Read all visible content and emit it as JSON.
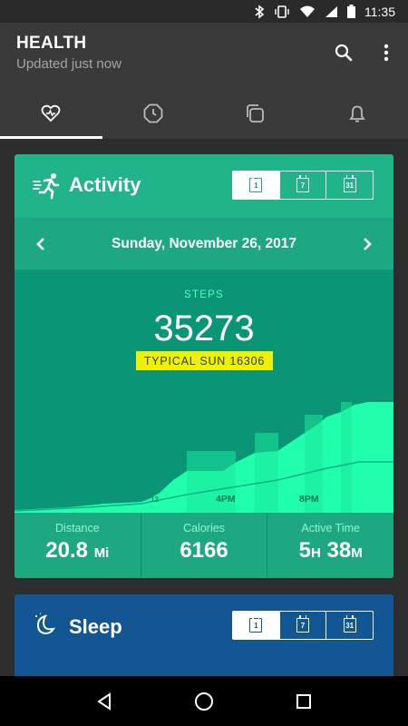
{
  "status_bar": {
    "time": "11:35"
  },
  "app_bar": {
    "title": "HEALTH",
    "subtitle": "Updated just now"
  },
  "tabs": [
    {
      "icon": "heart-pulse-icon",
      "active": true
    },
    {
      "icon": "clock-icon",
      "active": false
    },
    {
      "icon": "copy-icon",
      "active": false
    },
    {
      "icon": "bell-icon",
      "active": false
    }
  ],
  "activity": {
    "title": "Activity",
    "ranges": [
      "1",
      "7",
      "31"
    ],
    "selected_range": "1",
    "date": "Sunday, November 26, 2017",
    "steps_label": "STEPS",
    "steps_value": "35273",
    "typical_badge": "TYPICAL SUN 16306",
    "axis_labels": {
      "noon": "12",
      "pm4": "4PM",
      "pm8": "8PM"
    },
    "stats": {
      "distance": {
        "label": "Distance",
        "value": "20.8",
        "unit": "Mi"
      },
      "calories": {
        "label": "Calories",
        "value": "6166"
      },
      "active_time": {
        "label": "Active Time",
        "hours": "5",
        "hours_unit": "H",
        "minutes": "38",
        "minutes_unit": "M"
      }
    }
  },
  "sleep": {
    "title": "Sleep",
    "ranges": [
      "1",
      "7",
      "31"
    ],
    "selected_range": "1"
  },
  "colors": {
    "activity_card": "#22b489",
    "chart_bg": "#0a9577",
    "chart_fill": "#1fffac",
    "typical_badge": "#eef200",
    "sleep_card": "#125693"
  }
}
